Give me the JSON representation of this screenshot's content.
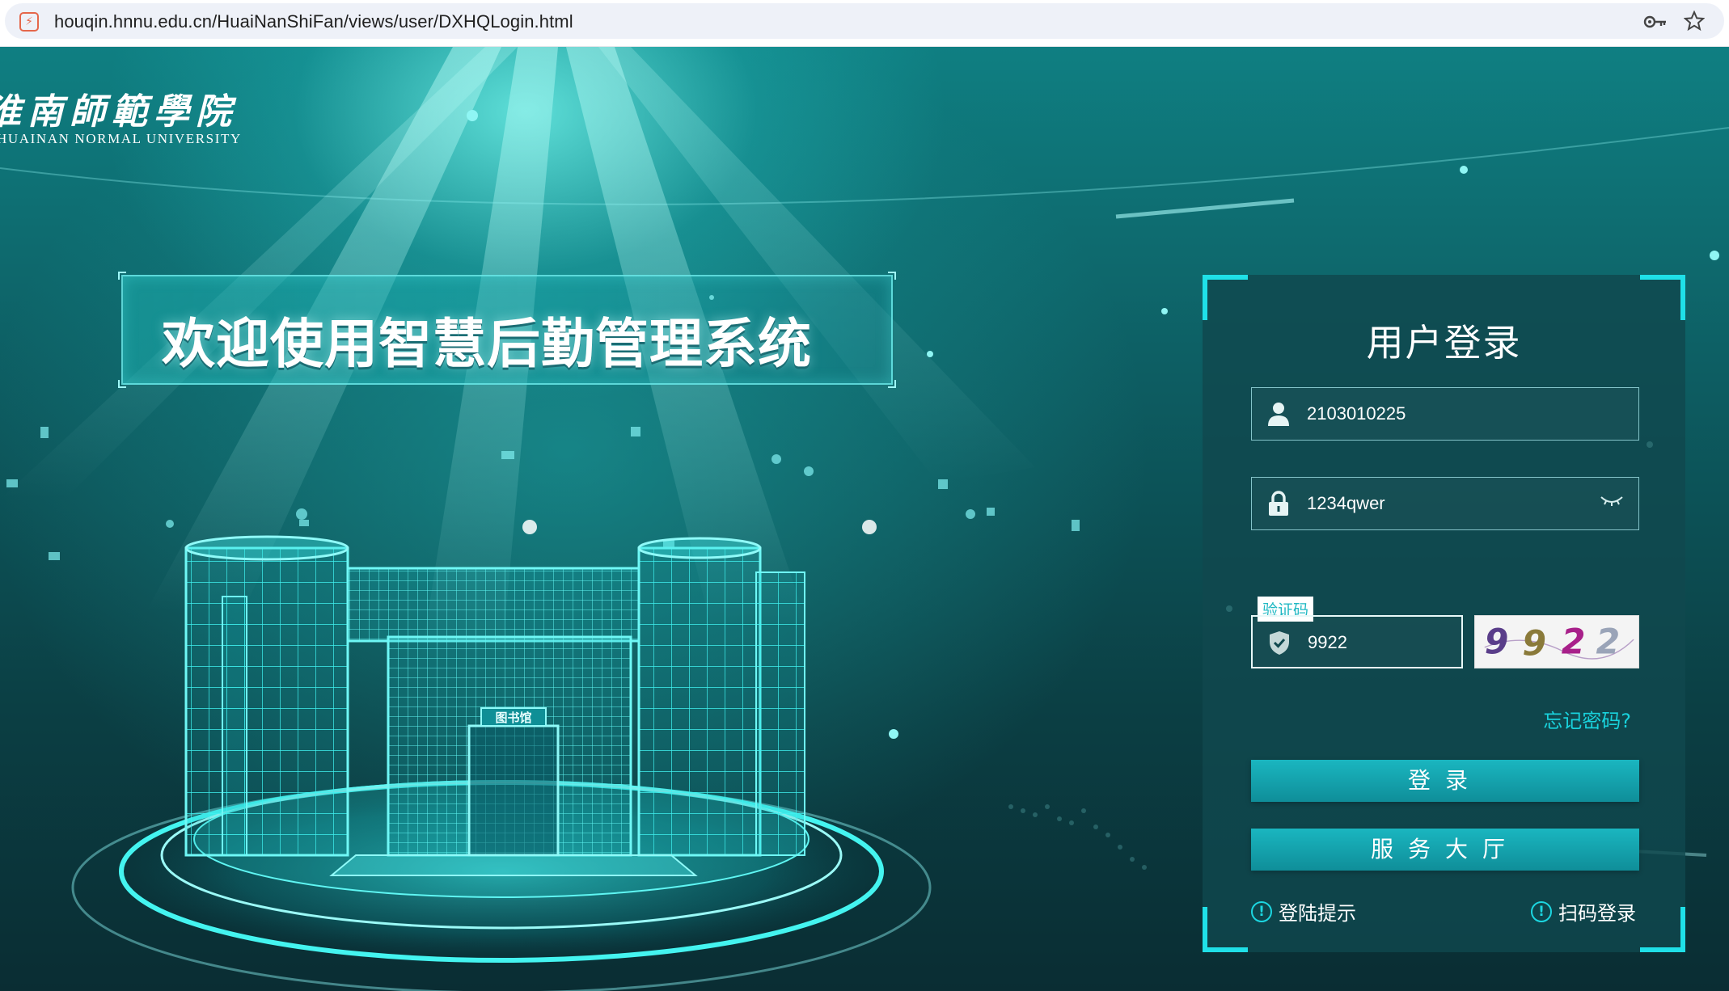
{
  "browser": {
    "url": "houqin.hnnu.edu.cn/HuaiNanShiFan/views/user/DXHQLogin.html",
    "site_icon": "site-favicon",
    "key_icon": "password-key-icon",
    "star_icon": "bookmark-star-icon"
  },
  "header": {
    "logo_cn": "淮南師範學院",
    "logo_en": "HUAINAN NORMAL UNIVERSITY"
  },
  "banner": {
    "welcome": "欢迎使用智慧后勤管理系统",
    "library_label": "图书馆"
  },
  "login": {
    "title": "用户登录",
    "username": "2103010225",
    "password": "1234qwer",
    "captcha_tag": "验证码",
    "captcha_value": "9922",
    "captcha_image_text": "9922",
    "forgot": "忘记密码?",
    "login_button": "登录",
    "hall_button": "服务大厅",
    "hint_login": "登陆提示",
    "hint_qr": "扫码登录"
  },
  "colors": {
    "accent": "#1fe0e8",
    "button": "#15a9b4",
    "link": "#19d2dc",
    "panel_bg": "#10484e"
  }
}
